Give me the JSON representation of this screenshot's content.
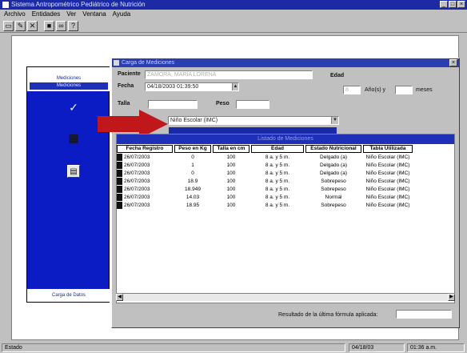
{
  "app": {
    "title": "Sistema Antropométrico Pediátrico de Nutrición"
  },
  "menu": [
    "Archivo",
    "Entidades",
    "Ver",
    "Ventana",
    "Ayuda"
  ],
  "toolbar_icons": [
    "new-icon",
    "edit-icon",
    "delete-icon",
    "save-icon",
    "binoculars-icon",
    "help-icon"
  ],
  "sidebar": {
    "tabs": [
      "Mediciones",
      "Mediciones"
    ],
    "footer": "Carga de Datos"
  },
  "window": {
    "title": "Carga de Mediciones"
  },
  "form": {
    "paciente_label": "Paciente",
    "paciente_value": "ZAMORA, MARÍA LORENA",
    "fecha_label": "Fecha",
    "fecha_value": "04/18/2003 01:39:50",
    "talla_label": "Talla",
    "peso_label": "Peso",
    "edad_label": "Edad",
    "edad_value": "8",
    "anios_label": "Año(s) y",
    "meses_label": "meses",
    "tabla_value": "Niño Escolar (IMC)"
  },
  "table": {
    "caption": "Listado de Mediciones",
    "headers": [
      "Fecha Registro",
      "Peso en Kg",
      "Talla en cm",
      "Edad",
      "Estado Nutricional",
      "Tabla Utilizada"
    ],
    "rows": [
      [
        "26/07/2003",
        "0",
        "100",
        "8 a. y 5 m.",
        "Delgado (a)",
        "Niño Escolar (IMC)"
      ],
      [
        "26/07/2003",
        "1",
        "100",
        "8 a. y 5 m.",
        "Delgado (a)",
        "Niño Escolar (IMC)"
      ],
      [
        "26/07/2003",
        "0",
        "100",
        "8 a. y 5 m.",
        "Delgado (a)",
        "Niño Escolar (IMC)"
      ],
      [
        "26/07/2003",
        "18.9",
        "100",
        "8 a. y 5 m.",
        "Sobrepeso",
        "Niño Escolar (IMC)"
      ],
      [
        "26/07/2003",
        "18.949",
        "100",
        "8 a. y 5 m.",
        "Sobrepeso",
        "Niño Escolar (IMC)"
      ],
      [
        "26/07/2003",
        "14.03",
        "100",
        "8 a. y 5 m.",
        "Normal",
        "Niño Escolar (IMC)"
      ],
      [
        "26/07/2003",
        "18.95",
        "100",
        "8 a. y 5 m.",
        "Sobrepeso",
        "Niño Escolar (IMC)"
      ]
    ]
  },
  "footer": {
    "resultado_label": "Resultado de la última fórmula aplicada:"
  },
  "status": {
    "left": "Estado",
    "date": "04/18/03",
    "time": "01:36 a.m."
  },
  "colors": {
    "titlebar": "#1c2aa6",
    "sidebar": "#0b1cc4",
    "highlight": "#1e30b8",
    "arrow": "#c0181a"
  }
}
